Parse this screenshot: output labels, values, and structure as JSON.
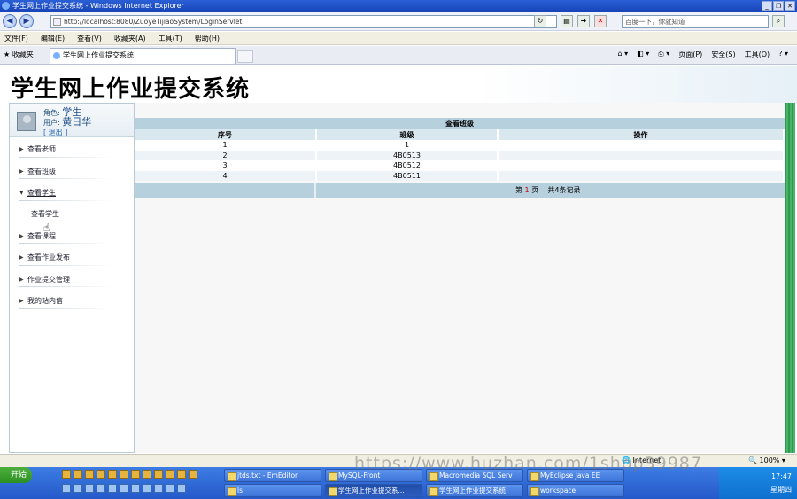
{
  "window": {
    "title": "学生网上作业提交系统 - Windows Internet Explorer"
  },
  "address": {
    "url": "http://localhost:8080/ZuoyeTijiaoSystem/LoginServlet"
  },
  "search": {
    "placeholder": "百度一下，你就知道"
  },
  "menubar": [
    "文件(F)",
    "编辑(E)",
    "查看(V)",
    "收藏夹(A)",
    "工具(T)",
    "帮助(H)"
  ],
  "favorites": {
    "label": "收藏夹"
  },
  "tab": {
    "title": "学生网上作业提交系统"
  },
  "commands": [
    "页面(P)",
    "安全(S)",
    "工具(O)"
  ],
  "banner": {
    "title": "学生网上作业提交系统"
  },
  "user": {
    "role_label": "角色:",
    "role": "学生",
    "user_label": "用户:",
    "name": "黄日华",
    "logout": "[ 退出 ]"
  },
  "sidebar": {
    "items": [
      {
        "label": "查看老师"
      },
      {
        "label": "查看班级"
      },
      {
        "label": "查看学生"
      },
      {
        "label": "查看课程"
      },
      {
        "label": "查看作业发布"
      },
      {
        "label": "作业提交管理"
      },
      {
        "label": "我的站内信"
      }
    ],
    "sub_item": "查看学生"
  },
  "content": {
    "title": "查看班级",
    "columns": [
      "序号",
      "班级",
      "操作"
    ],
    "rows": [
      [
        "1",
        "1",
        ""
      ],
      [
        "2",
        "4B0513",
        ""
      ],
      [
        "3",
        "4B0512",
        ""
      ],
      [
        "4",
        "4B0511",
        ""
      ]
    ],
    "pager": {
      "prefix": "第",
      "page": "1",
      "suffix": "页",
      "total": "共4条记录"
    }
  },
  "status": {
    "zone": "Internet",
    "zoom": "100%"
  },
  "taskbar": {
    "start": "开始",
    "buttons": [
      "jtds.txt - EmEditor",
      "MySQL-Front",
      "Macromedia SQL Serv",
      "MyEclipse Java EE",
      "ls",
      "学生网上作业提交系...",
      "学生网上作业提交系统",
      "workspace"
    ],
    "clock": "17:47",
    "day": "星期四"
  },
  "watermark": "https://www.huzhan.com/1shop39987"
}
